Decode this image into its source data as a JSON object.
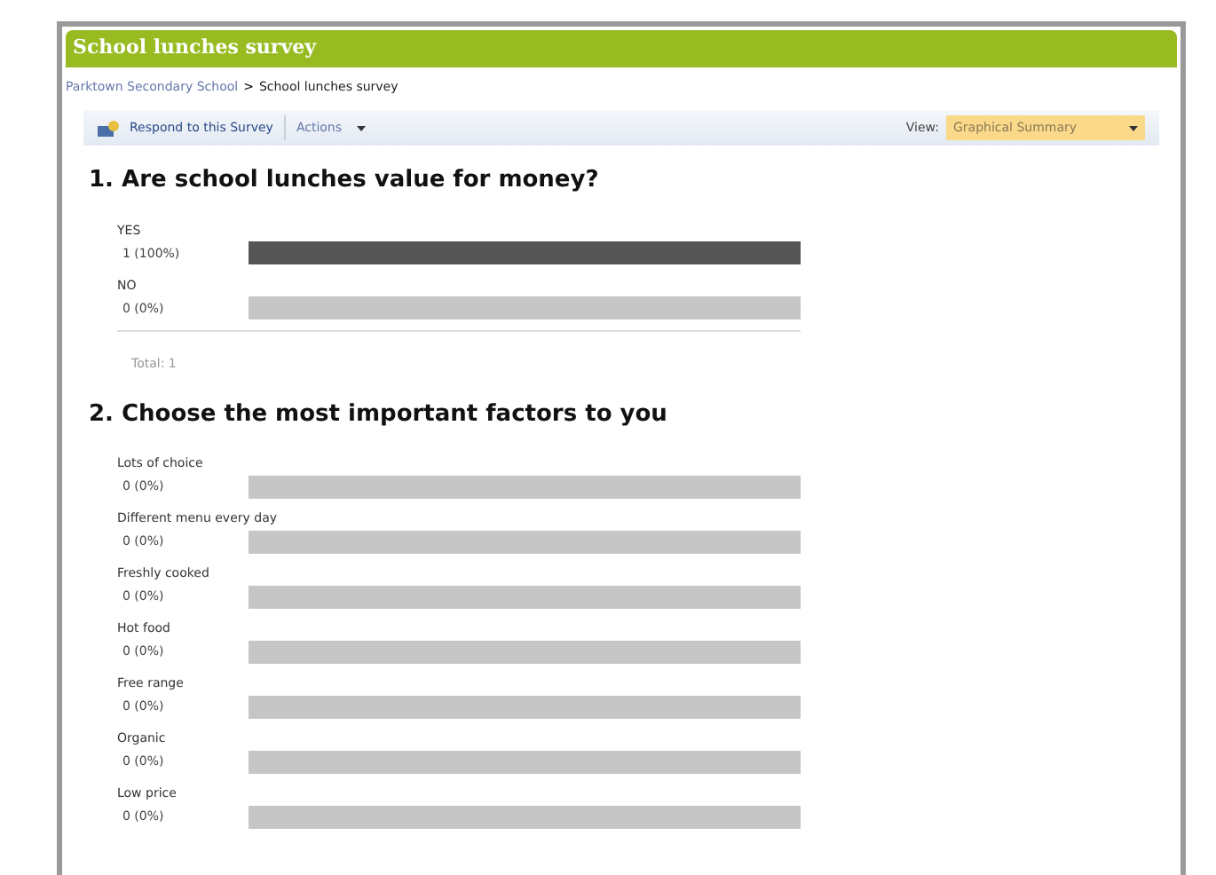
{
  "window": {
    "title": "School lunches survey"
  },
  "breadcrumb": {
    "parent": "Parktown Secondary School",
    "separator": ">",
    "current": "School lunches survey"
  },
  "toolbar": {
    "respond": "Respond to this Survey",
    "actions": "Actions",
    "view_label": "View:",
    "view_value": "Graphical Summary"
  },
  "questions": [
    {
      "title": "1. Are school lunches value for money?",
      "total": "Total: 1",
      "answers": [
        {
          "label": "YES",
          "count": "1 (100%)",
          "level": 1
        },
        {
          "label": "NO",
          "count": "0 (0%)",
          "level": 0
        }
      ]
    },
    {
      "title": "2. Choose the most important factors to you",
      "answers": [
        {
          "label": "Lots of choice",
          "count": "0 (0%)",
          "level": 0
        },
        {
          "label": "Different menu every day",
          "count": "0 (0%)",
          "level": 0
        },
        {
          "label": "Freshly cooked",
          "count": "0 (0%)",
          "level": 0
        },
        {
          "label": "Hot food",
          "count": "0 (0%)",
          "level": 0
        },
        {
          "label": "Free range",
          "count": "0 (0%)",
          "level": 0
        },
        {
          "label": "Organic",
          "count": "0 (0%)",
          "level": 0
        },
        {
          "label": "Low price",
          "count": "0 (0%)",
          "level": 0
        }
      ]
    }
  ]
}
